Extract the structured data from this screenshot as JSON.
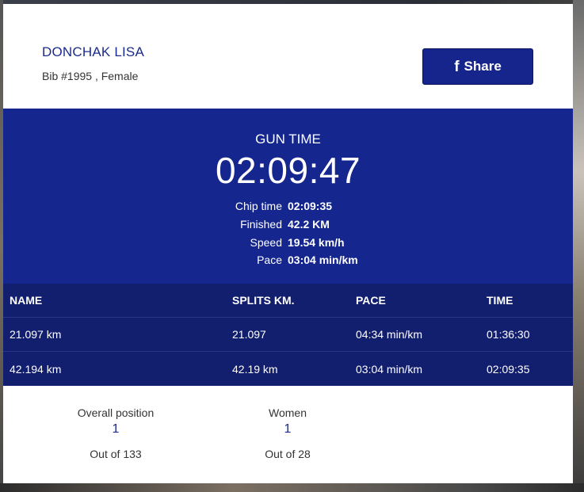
{
  "athlete": {
    "name": "DONCHAK LISA",
    "meta": "Bib #1995 , Female"
  },
  "share": {
    "label": "Share",
    "icon": "facebook-icon",
    "glyph": "f"
  },
  "gun": {
    "label": "GUN TIME",
    "time": "02:09:47"
  },
  "stats": [
    {
      "label": "Chip time",
      "value": "02:09:35"
    },
    {
      "label": "Finished",
      "value": "42.2 KM"
    },
    {
      "label": "Speed",
      "value": "19.54 km/h"
    },
    {
      "label": "Pace",
      "value": "03:04 min/km"
    }
  ],
  "splits": {
    "headers": [
      "NAME",
      "SPLITS KM.",
      "PACE",
      "TIME"
    ],
    "rows": [
      [
        "21.097 km",
        "21.097",
        "04:34 min/km",
        "01:36:30"
      ],
      [
        "42.194 km",
        "42.19 km",
        "03:04 min/km",
        "02:09:35"
      ]
    ]
  },
  "positions": [
    {
      "label": "Overall position",
      "value": "1",
      "out": "Out of 133"
    },
    {
      "label": "Women",
      "value": "1",
      "out": "Out of 28"
    }
  ],
  "colors": {
    "brand_blue": "#15268f",
    "table_blue": "#121e6e",
    "link_blue": "#1a2b8c"
  }
}
